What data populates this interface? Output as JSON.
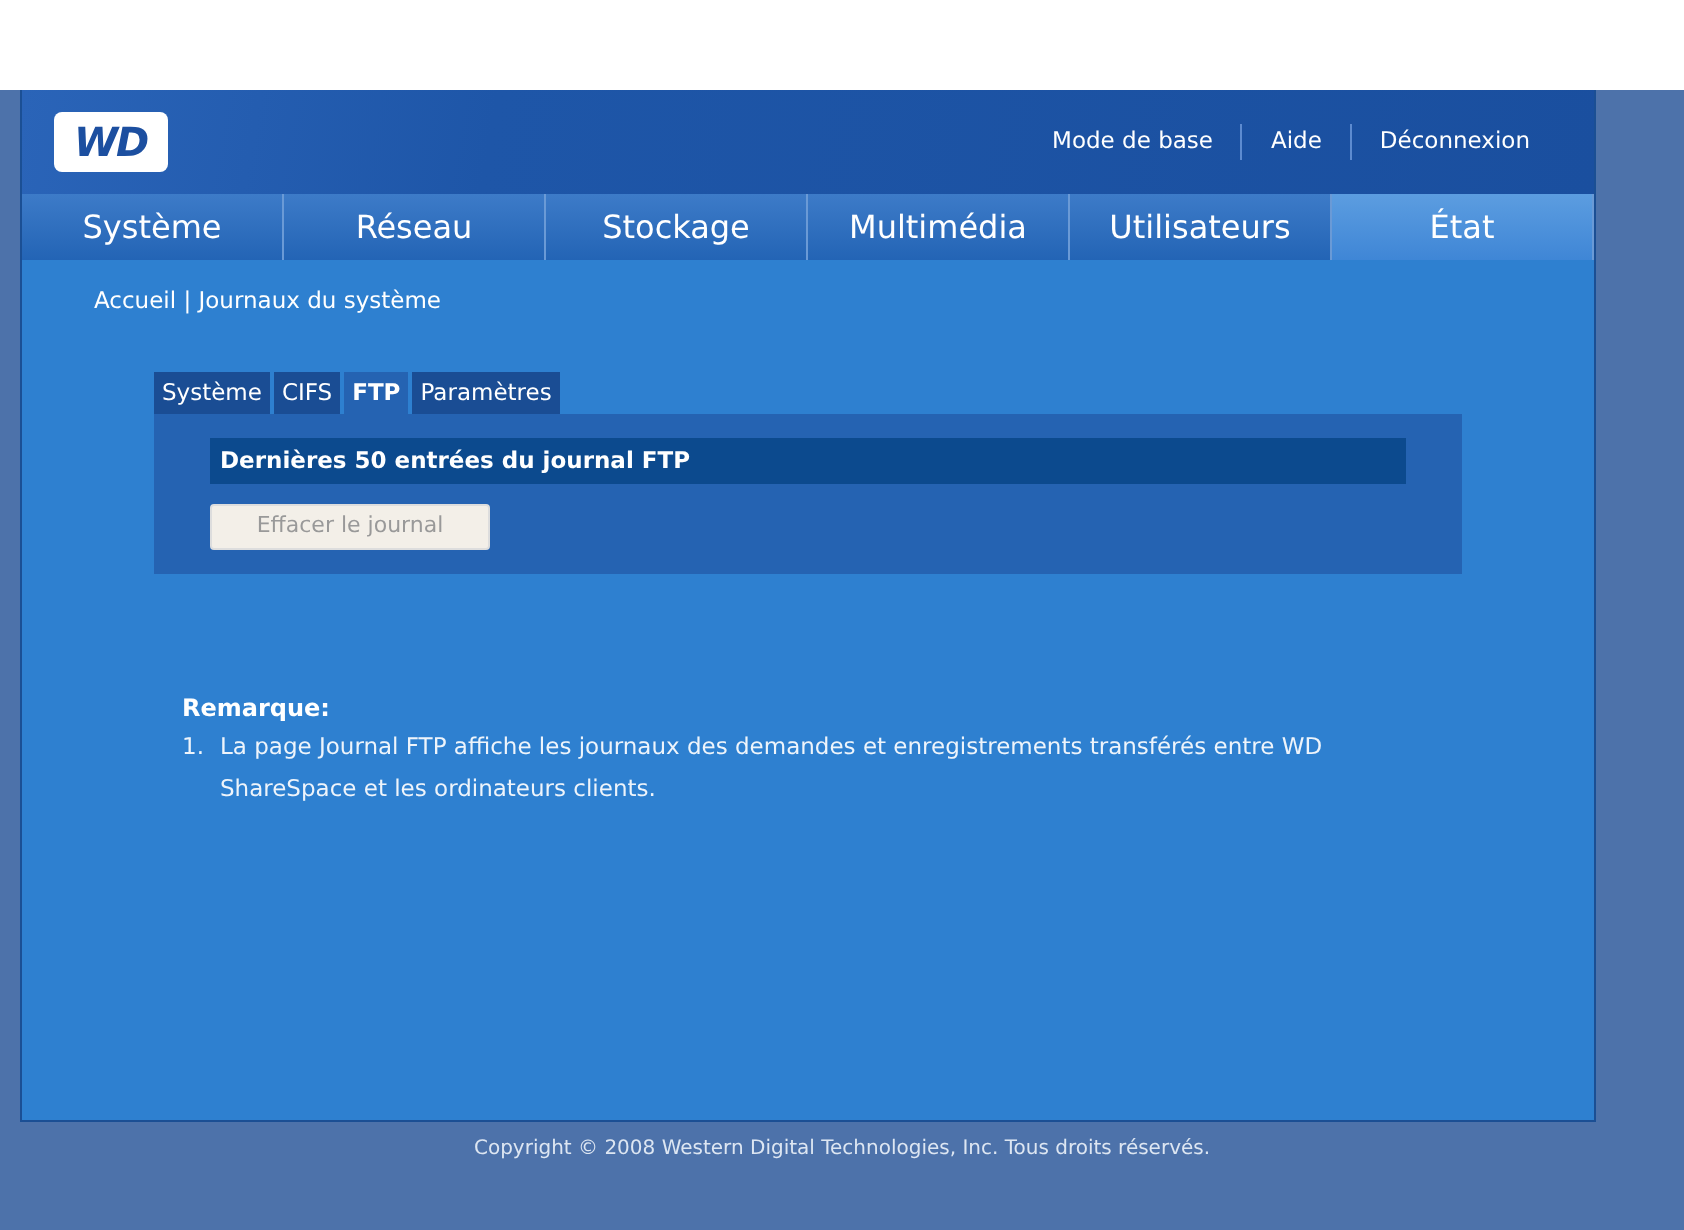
{
  "header": {
    "logo": "WD",
    "links": [
      "Mode de base",
      "Aide",
      "Déconnexion"
    ]
  },
  "nav": [
    {
      "label": "Système",
      "selected": false
    },
    {
      "label": "Réseau",
      "selected": false
    },
    {
      "label": "Stockage",
      "selected": false
    },
    {
      "label": "Multimédia",
      "selected": false
    },
    {
      "label": "Utilisateurs",
      "selected": false
    },
    {
      "label": "État",
      "selected": true
    }
  ],
  "breadcrumb": "Accueil | Journaux du système",
  "tabs": [
    {
      "label": "Système",
      "selected": false
    },
    {
      "label": "CIFS",
      "selected": false
    },
    {
      "label": "FTP",
      "selected": true
    },
    {
      "label": "Paramètres",
      "selected": false
    }
  ],
  "panel": {
    "title": "Dernières 50 entrées du journal FTP",
    "button": {
      "label": "Effacer le journal",
      "disabled": true
    }
  },
  "note": {
    "title": "Remarque:",
    "items": [
      {
        "number": "1.",
        "text": "La page Journal FTP affiche les journaux des demandes et enregistrements transférés entre WD ShareSpace et les ordinateurs clients."
      }
    ]
  },
  "footer": "Copyright © 2008 Western Digital Technologies, Inc. Tous droits réservés."
}
